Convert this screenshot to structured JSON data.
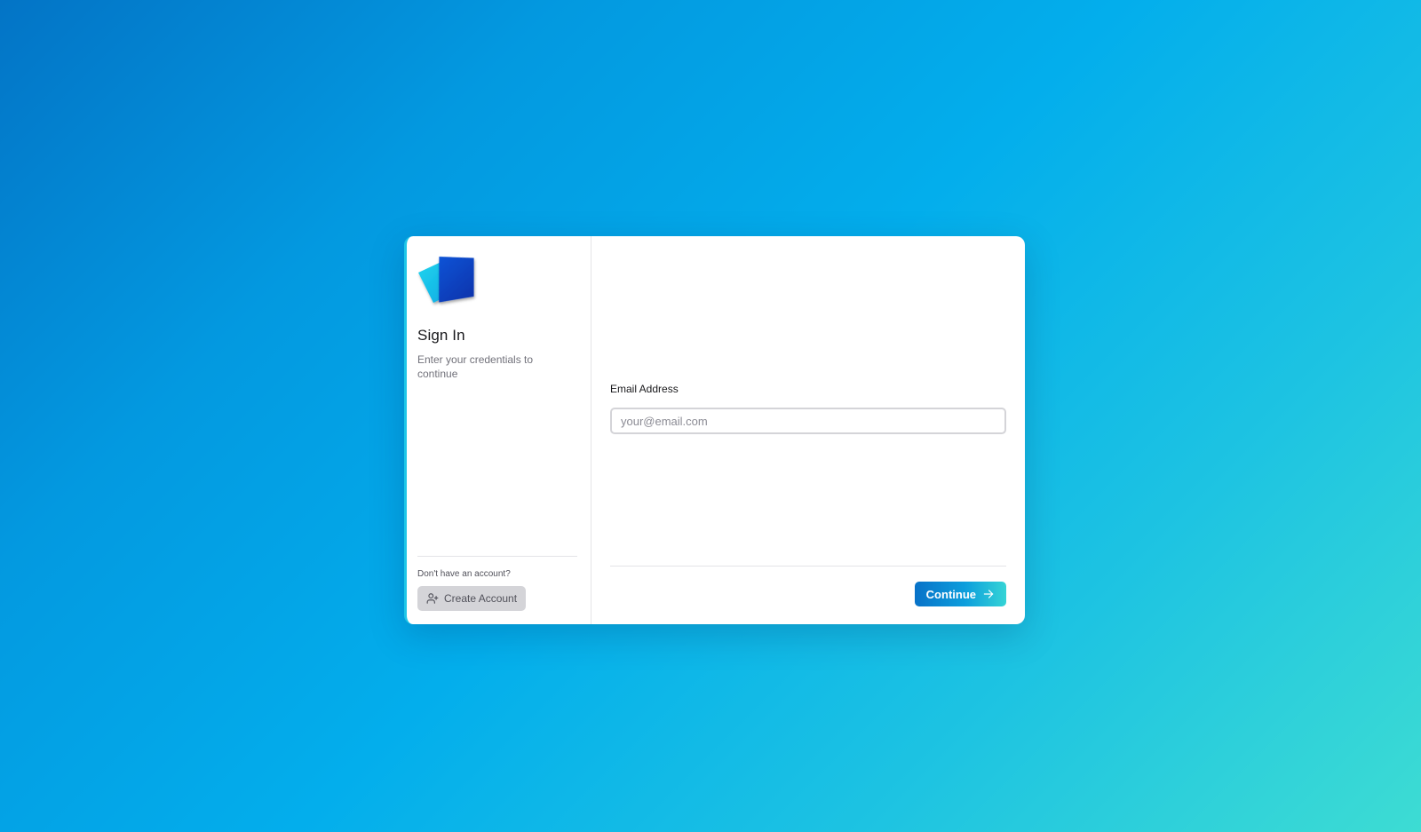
{
  "signin": {
    "title": "Sign In",
    "subtitle": "Enter your credentials to continue",
    "no_account_text": "Don't have an account?",
    "create_account_label": "Create Account"
  },
  "form": {
    "email_label": "Email Address",
    "email_value": "",
    "email_placeholder": "your@email.com",
    "continue_label": "Continue"
  },
  "icons": {
    "logo": "app-logo",
    "create_account": "user-plus-icon",
    "continue": "arrow-right-icon"
  },
  "colors": {
    "accent": "#0872c8",
    "accent_end": "#35d4d6",
    "logo_front": "#0a3fc4",
    "logo_back": "#1ec6e8"
  }
}
